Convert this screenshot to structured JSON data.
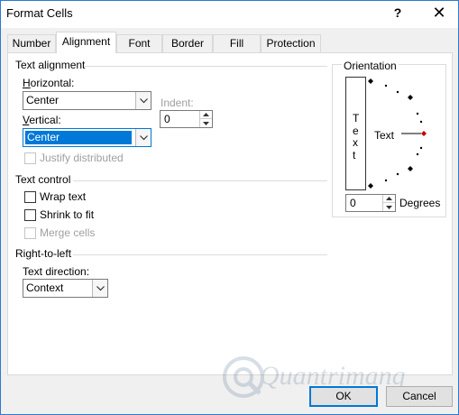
{
  "window": {
    "title": "Format Cells",
    "help_label": "?",
    "close_label": "✕"
  },
  "tabs": [
    "Number",
    "Alignment",
    "Font",
    "Border",
    "Fill",
    "Protection"
  ],
  "active_tab": "Alignment",
  "text_alignment": {
    "section_label": "Text alignment",
    "horizontal_label": "Horizontal:",
    "horizontal_value": "Center",
    "indent_label": "Indent:",
    "indent_value": "0",
    "vertical_label": "Vertical:",
    "vertical_value": "Center",
    "justify_distributed_label": "Justify distributed"
  },
  "text_control": {
    "section_label": "Text control",
    "wrap_text_label": "Wrap text",
    "shrink_to_fit_label": "Shrink to fit",
    "merge_cells_label": "Merge cells"
  },
  "right_to_left": {
    "section_label": "Right-to-left",
    "text_direction_label": "Text direction:",
    "text_direction_value": "Context"
  },
  "orientation": {
    "section_label": "Orientation",
    "vertical_text_letters": [
      "T",
      "e",
      "x",
      "t"
    ],
    "dial_text": "Text",
    "degrees_value": "0",
    "degrees_label": "Degrees",
    "indicator_color": "#c00000"
  },
  "buttons": {
    "ok_label": "OK",
    "cancel_label": "Cancel"
  },
  "watermark": {
    "text": "Quantrimang"
  },
  "colors": {
    "focus": "#0078d7",
    "border": "#2b79d0"
  }
}
